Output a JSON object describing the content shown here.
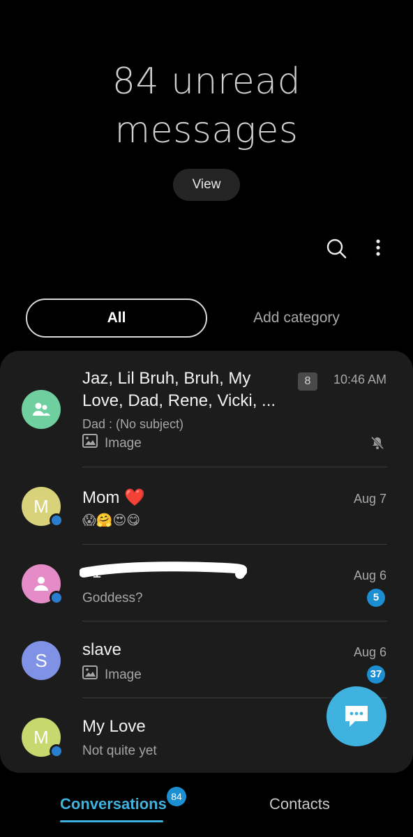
{
  "header": {
    "unread_line1": "84 unread",
    "unread_line2": "messages",
    "view_label": "View"
  },
  "toolbar": {
    "icons": [
      "search-icon",
      "more-vert-icon"
    ]
  },
  "tabs": {
    "all_label": "All",
    "add_category_label": "Add category"
  },
  "conversations": [
    {
      "name_line1": "Jaz, Lil Bruh, Bruh, My",
      "name_line2": "Love, Dad, Rene, Vicki, ...",
      "count": "8",
      "time": "10:46 AM",
      "preview_line1": "Dad : (No subject)",
      "preview_line2": "Image",
      "muted": true,
      "avatar_color": "#6fcf9f",
      "avatar_icon": "group-icon"
    },
    {
      "name": "Mom",
      "name_emoji": "❤️",
      "time": "Aug 7",
      "preview": "😱🤗😍😋",
      "avatar_letter": "M",
      "avatar_color": "#d8d27a"
    },
    {
      "name": "+1",
      "time": "Aug 6",
      "preview": "Goddess?",
      "unread": "5",
      "avatar_color": "#e58cc8",
      "avatar_icon": "person-icon"
    },
    {
      "name": "slave",
      "time": "Aug 6",
      "preview": "Image",
      "unread": "37",
      "avatar_letter": "S",
      "avatar_color": "#7f92e6"
    },
    {
      "name": "My Love",
      "preview": "Not quite yet",
      "avatar_letter": "M",
      "avatar_color": "#c6d86e"
    }
  ],
  "bottom_nav": {
    "conversations_label": "Conversations",
    "conversations_badge": "84",
    "contacts_label": "Contacts"
  },
  "colors": {
    "accent": "#3fb2e0",
    "badge": "#1b8fd1",
    "card": "#1c1c1c",
    "background": "#000000"
  }
}
